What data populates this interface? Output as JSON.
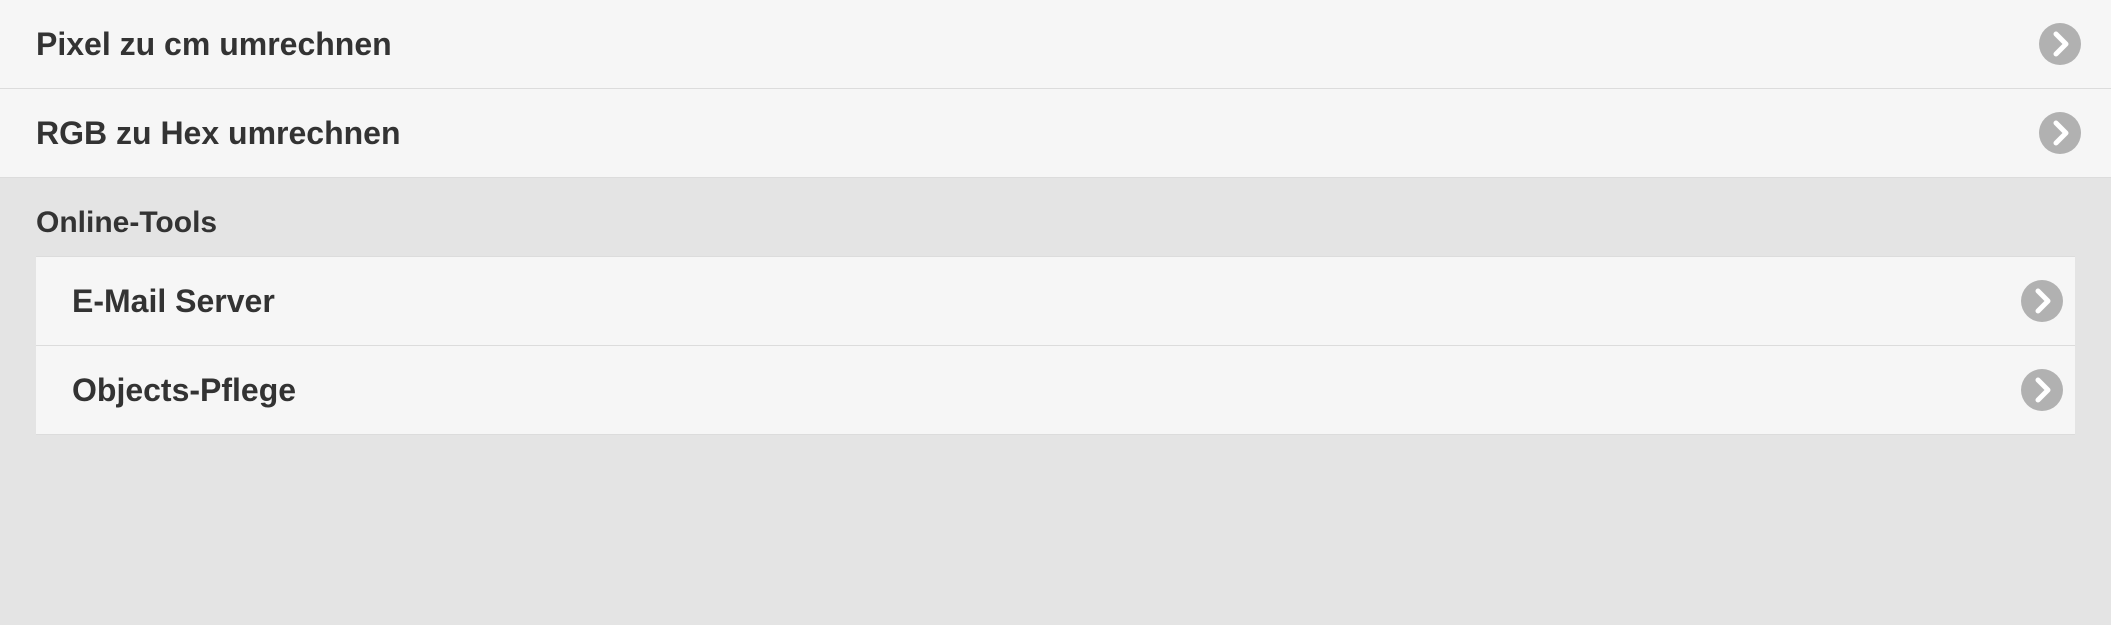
{
  "topList": [
    {
      "label": "Pixel zu cm umrechnen"
    },
    {
      "label": "RGB zu Hex umrechnen"
    }
  ],
  "section": {
    "header": "Online-Tools",
    "items": [
      {
        "label": "E-Mail Server"
      },
      {
        "label": "Objects-Pflege"
      }
    ]
  }
}
